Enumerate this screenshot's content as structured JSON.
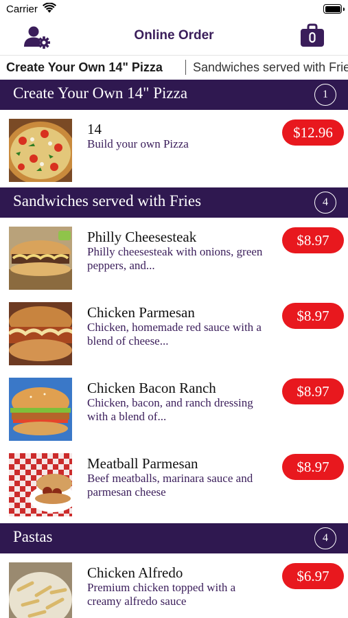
{
  "status_bar": {
    "carrier": "Carrier",
    "time": ""
  },
  "nav": {
    "title": "Online Order",
    "left_icon": "user-settings-icon",
    "right_icon": "shopping-bag-icon"
  },
  "tabs": [
    {
      "label": "Create Your Own 14\" Pizza"
    },
    {
      "label": "Sandwiches served with Fries"
    }
  ],
  "sections": [
    {
      "title": "Create Your Own 14\" Pizza",
      "count": "1",
      "items": [
        {
          "name": "14",
          "description": "Build your own Pizza",
          "price": "$12.96",
          "image": "pizza"
        }
      ]
    },
    {
      "title": "Sandwiches served with Fries",
      "count": "4",
      "items": [
        {
          "name": "Philly Cheesesteak",
          "description": "Philly cheesesteak with onions, green peppers, and...",
          "price": "$8.97",
          "image": "philly"
        },
        {
          "name": "Chicken Parmesan",
          "description": "Chicken, homemade red sauce with a blend of cheese...",
          "price": "$8.97",
          "image": "chicken-parm"
        },
        {
          "name": "Chicken Bacon Ranch",
          "description": "Chicken, bacon, and ranch dressing with a blend of...",
          "price": "$8.97",
          "image": "chicken-bacon"
        },
        {
          "name": "Meatball Parmesan",
          "description": "Beef meatballs, marinara sauce and parmesan cheese",
          "price": "$8.97",
          "image": "meatball"
        }
      ]
    },
    {
      "title": "Pastas",
      "count": "4",
      "items": [
        {
          "name": "Chicken Alfredo",
          "description": "Premium chicken topped with a creamy alfredo sauce",
          "price": "$6.97",
          "image": "alfredo"
        }
      ]
    }
  ],
  "colors": {
    "header_purple": "#2f1850",
    "title_purple": "#3a1d5a",
    "price_red": "#e8181e"
  }
}
